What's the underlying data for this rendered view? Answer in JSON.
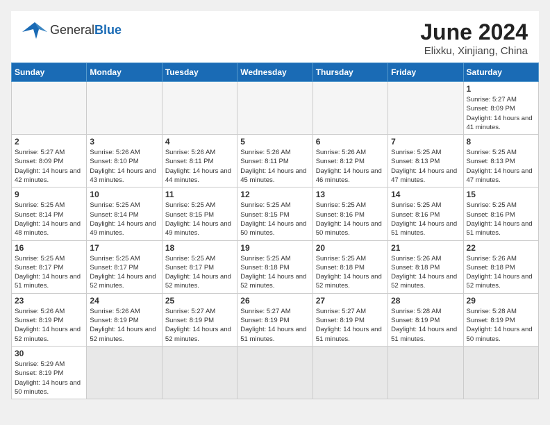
{
  "header": {
    "logo_general": "General",
    "logo_blue": "Blue",
    "title": "June 2024",
    "subtitle": "Elixku, Xinjiang, China"
  },
  "days_of_week": [
    "Sunday",
    "Monday",
    "Tuesday",
    "Wednesday",
    "Thursday",
    "Friday",
    "Saturday"
  ],
  "weeks": [
    [
      {
        "day": "",
        "empty": true
      },
      {
        "day": "",
        "empty": true
      },
      {
        "day": "",
        "empty": true
      },
      {
        "day": "",
        "empty": true
      },
      {
        "day": "",
        "empty": true
      },
      {
        "day": "",
        "empty": true
      },
      {
        "day": "1",
        "sunrise": "5:27 AM",
        "sunset": "8:09 PM",
        "daylight": "14 hours and 41 minutes."
      }
    ],
    [
      {
        "day": "2",
        "sunrise": "5:27 AM",
        "sunset": "8:09 PM",
        "daylight": "14 hours and 42 minutes."
      },
      {
        "day": "3",
        "sunrise": "5:26 AM",
        "sunset": "8:10 PM",
        "daylight": "14 hours and 43 minutes."
      },
      {
        "day": "4",
        "sunrise": "5:26 AM",
        "sunset": "8:11 PM",
        "daylight": "14 hours and 44 minutes."
      },
      {
        "day": "5",
        "sunrise": "5:26 AM",
        "sunset": "8:11 PM",
        "daylight": "14 hours and 45 minutes."
      },
      {
        "day": "6",
        "sunrise": "5:26 AM",
        "sunset": "8:12 PM",
        "daylight": "14 hours and 46 minutes."
      },
      {
        "day": "7",
        "sunrise": "5:25 AM",
        "sunset": "8:13 PM",
        "daylight": "14 hours and 47 minutes."
      },
      {
        "day": "8",
        "sunrise": "5:25 AM",
        "sunset": "8:13 PM",
        "daylight": "14 hours and 47 minutes."
      }
    ],
    [
      {
        "day": "9",
        "sunrise": "5:25 AM",
        "sunset": "8:14 PM",
        "daylight": "14 hours and 48 minutes."
      },
      {
        "day": "10",
        "sunrise": "5:25 AM",
        "sunset": "8:14 PM",
        "daylight": "14 hours and 49 minutes."
      },
      {
        "day": "11",
        "sunrise": "5:25 AM",
        "sunset": "8:15 PM",
        "daylight": "14 hours and 49 minutes."
      },
      {
        "day": "12",
        "sunrise": "5:25 AM",
        "sunset": "8:15 PM",
        "daylight": "14 hours and 50 minutes."
      },
      {
        "day": "13",
        "sunrise": "5:25 AM",
        "sunset": "8:16 PM",
        "daylight": "14 hours and 50 minutes."
      },
      {
        "day": "14",
        "sunrise": "5:25 AM",
        "sunset": "8:16 PM",
        "daylight": "14 hours and 51 minutes."
      },
      {
        "day": "15",
        "sunrise": "5:25 AM",
        "sunset": "8:16 PM",
        "daylight": "14 hours and 51 minutes."
      }
    ],
    [
      {
        "day": "16",
        "sunrise": "5:25 AM",
        "sunset": "8:17 PM",
        "daylight": "14 hours and 51 minutes."
      },
      {
        "day": "17",
        "sunrise": "5:25 AM",
        "sunset": "8:17 PM",
        "daylight": "14 hours and 52 minutes."
      },
      {
        "day": "18",
        "sunrise": "5:25 AM",
        "sunset": "8:17 PM",
        "daylight": "14 hours and 52 minutes."
      },
      {
        "day": "19",
        "sunrise": "5:25 AM",
        "sunset": "8:18 PM",
        "daylight": "14 hours and 52 minutes."
      },
      {
        "day": "20",
        "sunrise": "5:25 AM",
        "sunset": "8:18 PM",
        "daylight": "14 hours and 52 minutes."
      },
      {
        "day": "21",
        "sunrise": "5:26 AM",
        "sunset": "8:18 PM",
        "daylight": "14 hours and 52 minutes."
      },
      {
        "day": "22",
        "sunrise": "5:26 AM",
        "sunset": "8:18 PM",
        "daylight": "14 hours and 52 minutes."
      }
    ],
    [
      {
        "day": "23",
        "sunrise": "5:26 AM",
        "sunset": "8:19 PM",
        "daylight": "14 hours and 52 minutes."
      },
      {
        "day": "24",
        "sunrise": "5:26 AM",
        "sunset": "8:19 PM",
        "daylight": "14 hours and 52 minutes."
      },
      {
        "day": "25",
        "sunrise": "5:27 AM",
        "sunset": "8:19 PM",
        "daylight": "14 hours and 52 minutes."
      },
      {
        "day": "26",
        "sunrise": "5:27 AM",
        "sunset": "8:19 PM",
        "daylight": "14 hours and 51 minutes."
      },
      {
        "day": "27",
        "sunrise": "5:27 AM",
        "sunset": "8:19 PM",
        "daylight": "14 hours and 51 minutes."
      },
      {
        "day": "28",
        "sunrise": "5:28 AM",
        "sunset": "8:19 PM",
        "daylight": "14 hours and 51 minutes."
      },
      {
        "day": "29",
        "sunrise": "5:28 AM",
        "sunset": "8:19 PM",
        "daylight": "14 hours and 50 minutes."
      }
    ],
    [
      {
        "day": "30",
        "sunrise": "5:29 AM",
        "sunset": "8:19 PM",
        "daylight": "14 hours and 50 minutes."
      },
      {
        "day": "",
        "empty": true,
        "shaded": true
      },
      {
        "day": "",
        "empty": true,
        "shaded": true
      },
      {
        "day": "",
        "empty": true,
        "shaded": true
      },
      {
        "day": "",
        "empty": true,
        "shaded": true
      },
      {
        "day": "",
        "empty": true,
        "shaded": true
      },
      {
        "day": "",
        "empty": true,
        "shaded": true
      }
    ]
  ],
  "labels": {
    "sunrise": "Sunrise:",
    "sunset": "Sunset:",
    "daylight": "Daylight:"
  }
}
